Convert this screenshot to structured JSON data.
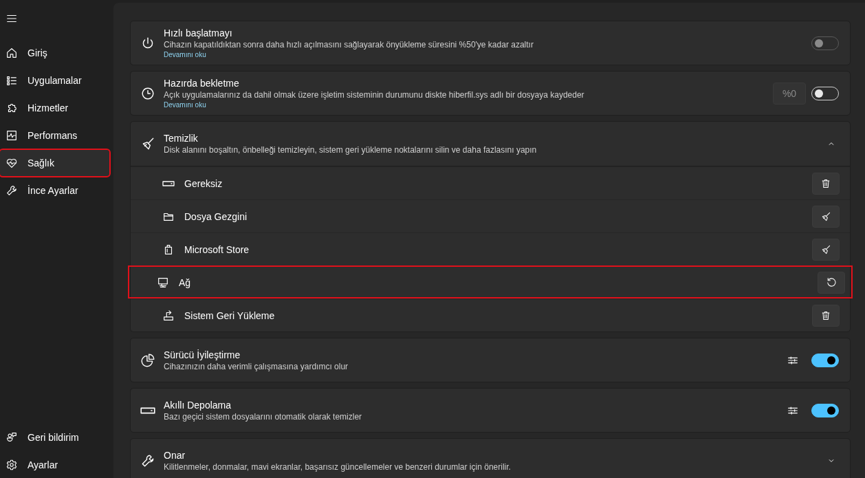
{
  "sidebar": {
    "items": [
      {
        "label": "Giriş",
        "selected": false,
        "highlighted": false
      },
      {
        "label": "Uygulamalar",
        "selected": false,
        "highlighted": false
      },
      {
        "label": "Hizmetler",
        "selected": false,
        "highlighted": false
      },
      {
        "label": "Performans",
        "selected": false,
        "highlighted": false
      },
      {
        "label": "Sağlık",
        "selected": true,
        "highlighted": true
      },
      {
        "label": "İnce Ayarlar",
        "selected": false,
        "highlighted": false
      }
    ],
    "footer_items": [
      {
        "label": "Geri bildirim",
        "selected": false,
        "highlighted": false
      },
      {
        "label": "Ayarlar",
        "selected": false,
        "highlighted": false
      }
    ]
  },
  "cards": [
    {
      "kind": "toggle",
      "title": "Hızlı başlatmayı",
      "description": "Cihazın kapatıldıktan sonra daha hızlı açılmasını sağlayarak önyükleme süresini %50'ye kadar azaltır",
      "link": "Devamını oku",
      "toggle": {
        "on": false,
        "disabled": true
      }
    },
    {
      "kind": "toggle",
      "title": "Hazırda bekletme",
      "description": "Açık uygulamalarınız da dahil olmak üzere işletim sisteminin durumunu diskte hiberfil.sys adlı bir dosyaya kaydeder",
      "link": "Devamını oku",
      "input": {
        "value": "%0",
        "disabled": true
      },
      "toggle": {
        "on": false,
        "disabled": false
      }
    },
    {
      "kind": "expander",
      "title": "Temizlik",
      "description": "Disk alanını boşaltın, önbelleği temizleyin, sistem geri yükleme noktalarını silin ve daha fazlasını yapın",
      "expanded": true,
      "children": [
        {
          "label": "Gereksiz",
          "kind": "delete",
          "highlighted": false
        },
        {
          "label": "Dosya Gezgini",
          "kind": "clean",
          "highlighted": false
        },
        {
          "label": "Microsoft Store",
          "kind": "clean",
          "highlighted": false
        },
        {
          "label": "Ağ",
          "kind": "reset",
          "highlighted": true
        },
        {
          "label": "Sistem Geri Yükleme",
          "kind": "delete",
          "highlighted": false
        }
      ]
    },
    {
      "kind": "toggle-settings",
      "title": "Sürücü İyileştirme",
      "description": "Cihazınızın daha verimli çalışmasına yardımcı olur",
      "toggle": {
        "on": true
      }
    },
    {
      "kind": "toggle-settings",
      "title": "Akıllı Depolama",
      "description": "Bazı geçici sistem dosyalarını otomatik olarak temizler",
      "toggle": {
        "on": true
      }
    },
    {
      "kind": "expander",
      "title": "Onar",
      "description": "Kilitlenmeler, donmalar, mavi ekranlar, başarısız güncellemeler ve benzeri durumlar için önerilir.",
      "expanded": false
    }
  ]
}
